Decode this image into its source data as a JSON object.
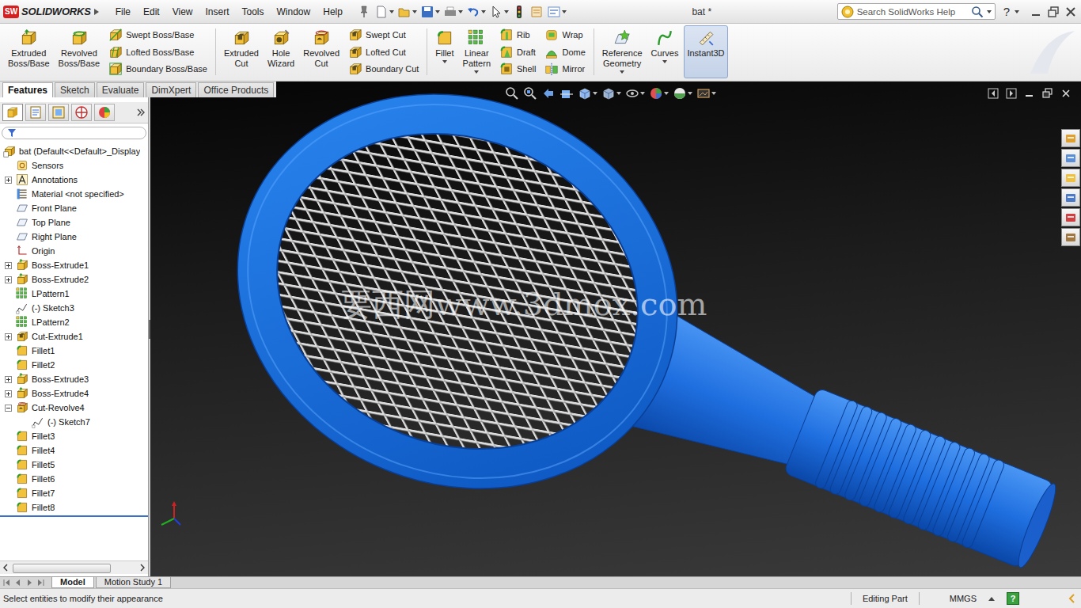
{
  "window": {
    "title": "bat *"
  },
  "app": {
    "logo_badge": "SW",
    "logo": "SOLIDWORKS"
  },
  "menu": [
    "File",
    "Edit",
    "View",
    "Insert",
    "Tools",
    "Window",
    "Help"
  ],
  "search": {
    "placeholder": "Search SolidWorks Help"
  },
  "help": "?",
  "ribbon": [
    {
      "blocks": [
        {
          "kind": "large",
          "icon": "boss",
          "lines": [
            "Extruded",
            "Boss/Base"
          ],
          "dropdown": false,
          "selected": false
        },
        {
          "kind": "large",
          "icon": "revolve",
          "lines": [
            "Revolved",
            "Boss/Base"
          ],
          "dropdown": false,
          "selected": false
        },
        {
          "kind": "stack",
          "items": [
            {
              "icon": "sweep",
              "label": "Swept Boss/Base",
              "selected": false
            },
            {
              "icon": "loft",
              "label": "Lofted Boss/Base",
              "selected": false
            },
            {
              "icon": "boundary",
              "label": "Boundary Boss/Base",
              "selected": false
            }
          ]
        }
      ]
    },
    {
      "blocks": [
        {
          "kind": "large",
          "icon": "cut",
          "lines": [
            "Extruded",
            "Cut"
          ],
          "dropdown": false,
          "selected": false
        },
        {
          "kind": "large",
          "icon": "hole",
          "lines": [
            "Hole",
            "Wizard"
          ],
          "dropdown": false,
          "selected": false
        },
        {
          "kind": "large",
          "icon": "revolve-cut",
          "lines": [
            "Revolved",
            "Cut"
          ],
          "dropdown": false,
          "selected": false
        },
        {
          "kind": "stack",
          "items": [
            {
              "icon": "sweep-cut",
              "label": "Swept Cut",
              "selected": false
            },
            {
              "icon": "loft-cut",
              "label": "Lofted Cut",
              "selected": false
            },
            {
              "icon": "boundary-cut",
              "label": "Boundary Cut",
              "selected": false
            }
          ]
        }
      ]
    },
    {
      "blocks": [
        {
          "kind": "large",
          "icon": "fillet",
          "lines": [
            "Fillet"
          ],
          "dropdown": true,
          "selected": false
        },
        {
          "kind": "large",
          "icon": "pattern",
          "lines": [
            "Linear",
            "Pattern"
          ],
          "dropdown": true,
          "selected": false
        },
        {
          "kind": "stack",
          "items": [
            {
              "icon": "rib",
              "label": "Rib",
              "selected": false
            },
            {
              "icon": "draft",
              "label": "Draft",
              "selected": false
            },
            {
              "icon": "shell",
              "label": "Shell",
              "selected": false
            }
          ]
        },
        {
          "kind": "stack",
          "items": [
            {
              "icon": "wrap",
              "label": "Wrap",
              "selected": false
            },
            {
              "icon": "dome",
              "label": "Dome",
              "selected": false
            },
            {
              "icon": "mirror",
              "label": "Mirror",
              "selected": false
            }
          ]
        }
      ]
    },
    {
      "blocks": [
        {
          "kind": "large",
          "icon": "reference",
          "lines": [
            "Reference",
            "Geometry"
          ],
          "dropdown": true,
          "selected": false
        },
        {
          "kind": "large",
          "icon": "curves",
          "lines": [
            "Curves"
          ],
          "dropdown": true,
          "selected": false
        },
        {
          "kind": "large",
          "icon": "instant3d",
          "lines": [
            "Instant3D"
          ],
          "dropdown": false,
          "selected": true
        }
      ]
    }
  ],
  "command_tabs": [
    {
      "label": "Features",
      "selected": true
    },
    {
      "label": "Sketch",
      "selected": false
    },
    {
      "label": "Evaluate",
      "selected": false
    },
    {
      "label": "DimXpert",
      "selected": false
    },
    {
      "label": "Office Products",
      "selected": false
    }
  ],
  "panel_tabs": [
    {
      "selected": true
    },
    {
      "selected": false
    },
    {
      "selected": false
    },
    {
      "selected": false
    },
    {
      "selected": false
    }
  ],
  "feature_tree": [
    {
      "label": "bat  (Default<<Default>_Display",
      "kind": "part",
      "depth": 0,
      "expandable": false,
      "expanded": false
    },
    {
      "label": "Sensors",
      "kind": "sensor",
      "depth": 1,
      "expandable": false,
      "expanded": false
    },
    {
      "label": "Annotations",
      "kind": "annotation",
      "depth": 1,
      "expandable": true,
      "expanded": false
    },
    {
      "label": "Material <not specified>",
      "kind": "material",
      "depth": 1,
      "expandable": false,
      "expanded": false
    },
    {
      "label": "Front Plane",
      "kind": "plane",
      "depth": 1,
      "expandable": false,
      "expanded": false
    },
    {
      "label": "Top Plane",
      "kind": "plane",
      "depth": 1,
      "expandable": false,
      "expanded": false
    },
    {
      "label": "Right Plane",
      "kind": "plane",
      "depth": 1,
      "expandable": false,
      "expanded": false
    },
    {
      "label": "Origin",
      "kind": "origin",
      "depth": 1,
      "expandable": false,
      "expanded": false
    },
    {
      "label": "Boss-Extrude1",
      "kind": "boss",
      "depth": 1,
      "expandable": true,
      "expanded": false
    },
    {
      "label": "Boss-Extrude2",
      "kind": "boss",
      "depth": 1,
      "expandable": true,
      "expanded": false
    },
    {
      "label": "LPattern1",
      "kind": "pattern",
      "depth": 1,
      "expandable": false,
      "expanded": false
    },
    {
      "label": "(-) Sketch3",
      "kind": "sketch",
      "depth": 1,
      "expandable": false,
      "expanded": false
    },
    {
      "label": "LPattern2",
      "kind": "pattern",
      "depth": 1,
      "expandable": false,
      "expanded": false
    },
    {
      "label": "Cut-Extrude1",
      "kind": "cut",
      "depth": 1,
      "expandable": true,
      "expanded": false
    },
    {
      "label": "Fillet1",
      "kind": "fillet",
      "depth": 1,
      "expandable": false,
      "expanded": false
    },
    {
      "label": "Fillet2",
      "kind": "fillet",
      "depth": 1,
      "expandable": false,
      "expanded": false
    },
    {
      "label": "Boss-Extrude3",
      "kind": "boss",
      "depth": 1,
      "expandable": true,
      "expanded": false
    },
    {
      "label": "Boss-Extrude4",
      "kind": "boss",
      "depth": 1,
      "expandable": true,
      "expanded": false
    },
    {
      "label": "Cut-Revolve4",
      "kind": "revolve-cut",
      "depth": 1,
      "expandable": true,
      "expanded": true
    },
    {
      "label": "(-) Sketch7",
      "kind": "sketch",
      "depth": 2,
      "expandable": false,
      "expanded": false
    },
    {
      "label": "Fillet3",
      "kind": "fillet",
      "depth": 1,
      "expandable": false,
      "expanded": false
    },
    {
      "label": "Fillet4",
      "kind": "fillet",
      "depth": 1,
      "expandable": false,
      "expanded": false
    },
    {
      "label": "Fillet5",
      "kind": "fillet",
      "depth": 1,
      "expandable": false,
      "expanded": false
    },
    {
      "label": "Fillet6",
      "kind": "fillet",
      "depth": 1,
      "expandable": false,
      "expanded": false
    },
    {
      "label": "Fillet7",
      "kind": "fillet",
      "depth": 1,
      "expandable": false,
      "expanded": false
    },
    {
      "label": "Fillet8",
      "kind": "fillet",
      "depth": 1,
      "expandable": false,
      "expanded": false
    }
  ],
  "viewport": {
    "watermark": "要西网www.3dmox.com"
  },
  "bottom_tabs": [
    {
      "label": "Model",
      "selected": true
    },
    {
      "label": "Motion Study 1",
      "selected": false
    }
  ],
  "status_bar": {
    "message": "Select entities to modify their appearance",
    "mode": "Editing Part",
    "units": "MMGS",
    "help": "?"
  }
}
